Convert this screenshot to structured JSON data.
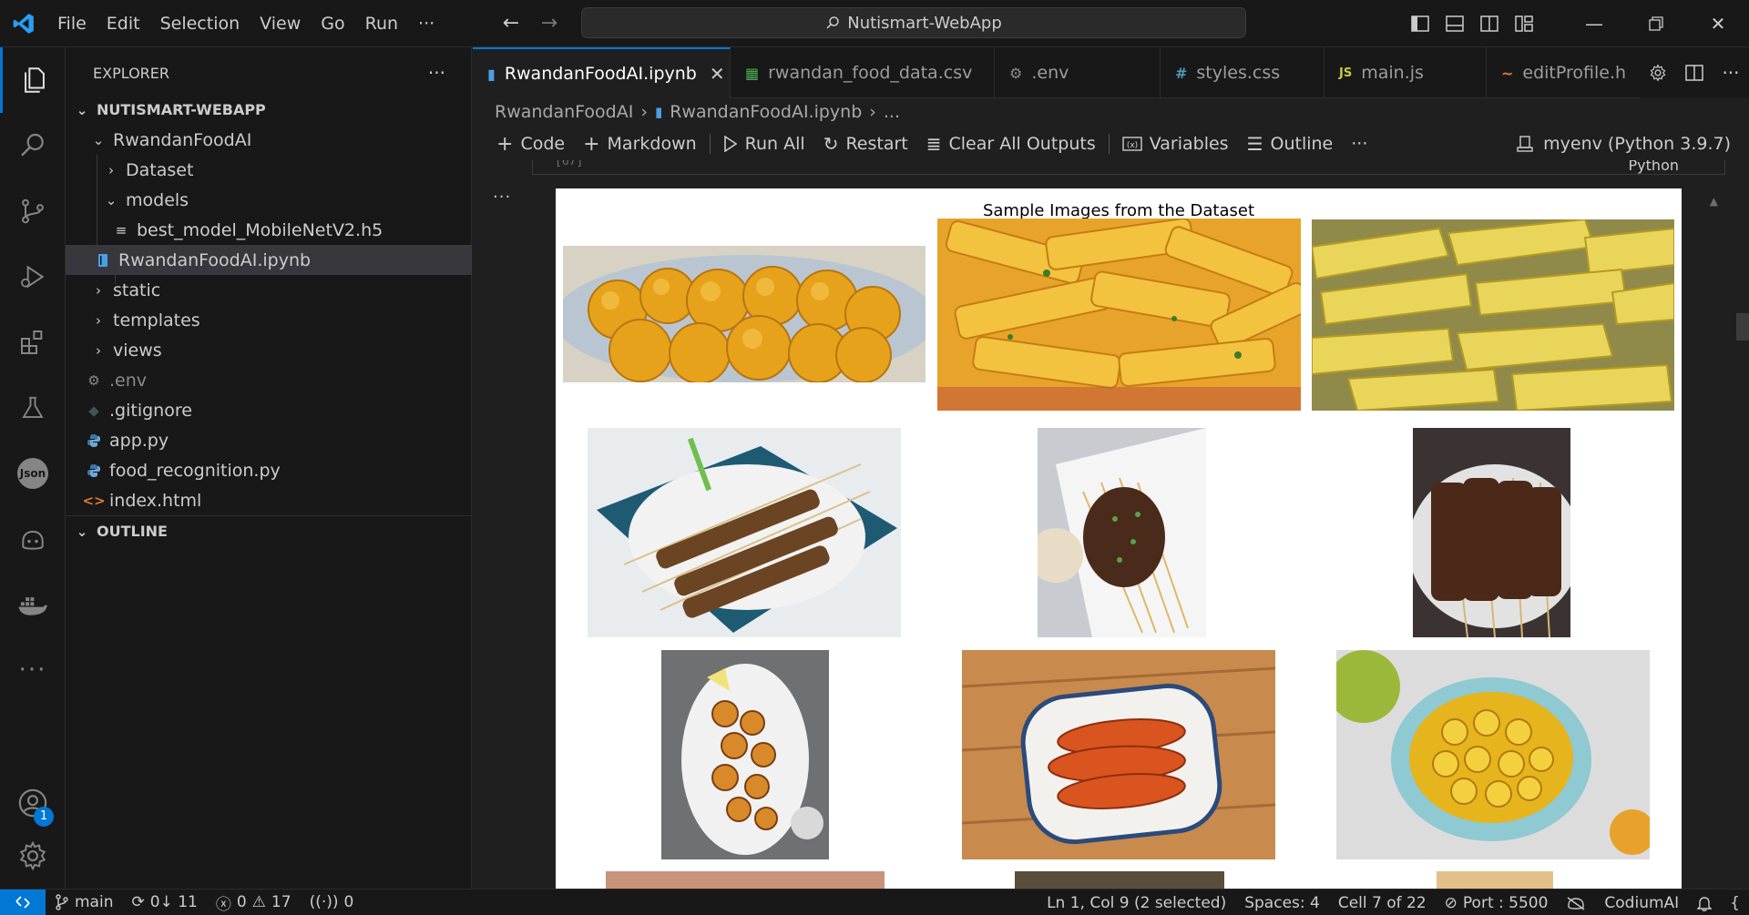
{
  "app": {
    "menu": [
      "File",
      "Edit",
      "Selection",
      "View",
      "Go",
      "Run"
    ],
    "more": "···",
    "command_center": "Nutismart-WebApp"
  },
  "sidebar": {
    "title": "EXPLORER",
    "more": "···",
    "project": "NUTISMART-WEBAPP",
    "tree": [
      {
        "label": "RwandanFoodAI",
        "kind": "folder-open"
      },
      {
        "label": "Dataset",
        "kind": "folder"
      },
      {
        "label": "models",
        "kind": "folder-open"
      },
      {
        "label": "best_model_MobileNetV2.h5",
        "kind": "file"
      },
      {
        "label": "RwandanFoodAI.ipynb",
        "kind": "notebook"
      },
      {
        "label": "static",
        "kind": "folder"
      },
      {
        "label": "templates",
        "kind": "folder"
      },
      {
        "label": "views",
        "kind": "folder"
      },
      {
        "label": ".env",
        "kind": "gear"
      },
      {
        "label": ".gitignore",
        "kind": "git"
      },
      {
        "label": "app.py",
        "kind": "python"
      },
      {
        "label": "food_recognition.py",
        "kind": "python"
      },
      {
        "label": "index.html",
        "kind": "html"
      }
    ],
    "outline": "OUTLINE"
  },
  "tabs": [
    {
      "label": "RwandanFoodAI.ipynb",
      "icon_text": "▮",
      "color": "#4aa0e6"
    },
    {
      "label": "rwandan_food_data.csv",
      "icon_text": "▦",
      "color": "#4caf50"
    },
    {
      "label": ".env",
      "icon_text": "⚙",
      "color": "#8b8b8b"
    },
    {
      "label": "styles.css",
      "icon_text": "#",
      "color": "#519aba"
    },
    {
      "label": "main.js",
      "icon_text": "JS",
      "color": "#cbcb41"
    },
    {
      "label": "editProfile.h",
      "icon_text": "~",
      "color": "#e37933"
    }
  ],
  "breadcrumb": [
    "RwandanFoodAI",
    "RwandanFoodAI.ipynb",
    "..."
  ],
  "toolbar": {
    "code": "Code",
    "markdown": "Markdown",
    "run_all": "Run All",
    "restart": "Restart",
    "clear": "Clear All Outputs",
    "variables": "Variables",
    "outline": "Outline",
    "more": "···",
    "kernel": "myenv (Python 3.9.7)"
  },
  "cell": {
    "exec_count": "[67]",
    "language": "Python",
    "output_dots": "···",
    "plot_title": "Sample Images from the Dataset"
  },
  "status": {
    "branch": "main",
    "sync": "0↓ 11",
    "errors": "0",
    "warnings": "17",
    "ports": "0",
    "position": "Ln 1, Col 9 (2 selected)",
    "spaces": "Spaces: 4",
    "cell": "Cell 7 of 22",
    "port": "Port : 5500",
    "codium": "CodiumAI"
  },
  "activity": {
    "accounts_badge": "1",
    "json_label": "Json"
  },
  "colors": {
    "accent": "#0078d4",
    "bg": "#1f1f1f",
    "sidebar": "#181818"
  }
}
